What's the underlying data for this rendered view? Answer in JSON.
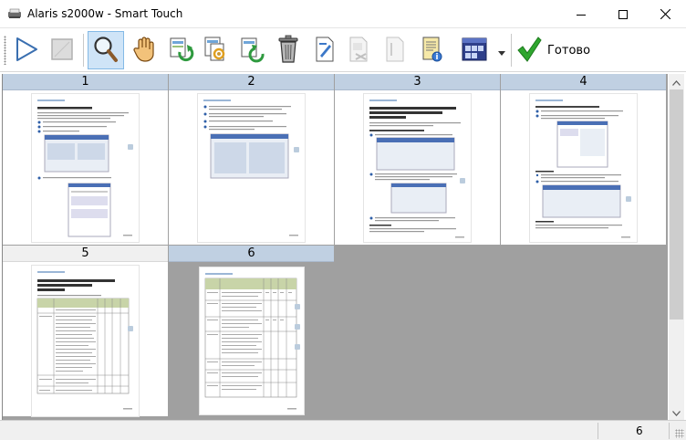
{
  "window": {
    "title": "Alaris s2000w - Smart Touch",
    "minimize_icon": "minimize-icon",
    "maximize_icon": "maximize-icon",
    "close_icon": "close-icon"
  },
  "toolbar": {
    "buttons": [
      {
        "name": "play-button",
        "icon": "play-icon"
      },
      {
        "name": "stop-button",
        "icon": "stop-icon",
        "disabled": true
      },
      {
        "name": "zoom-button",
        "icon": "magnifier-icon",
        "active": true
      },
      {
        "name": "pan-button",
        "icon": "hand-icon"
      },
      {
        "name": "rotate-right-button",
        "icon": "rotate-right-icon"
      },
      {
        "name": "rotate-left-button",
        "icon": "rotate-left-icon"
      },
      {
        "name": "flip-button",
        "icon": "flip-icon"
      },
      {
        "name": "delete-button",
        "icon": "trash-icon"
      },
      {
        "name": "insert-page-button",
        "icon": "insert-page-icon"
      },
      {
        "name": "crop-button",
        "icon": "crop-icon",
        "disabled": true
      },
      {
        "name": "split-button",
        "icon": "split-page-icon",
        "disabled": true
      },
      {
        "name": "page-info-button",
        "icon": "page-info-icon"
      },
      {
        "name": "view-mode-button",
        "icon": "view-mode-icon"
      }
    ],
    "done_label": "Готово",
    "done_icon": "checkmark-icon"
  },
  "pages": [
    {
      "number": "1"
    },
    {
      "number": "2"
    },
    {
      "number": "3"
    },
    {
      "number": "4"
    },
    {
      "number": "5"
    },
    {
      "number": "6",
      "selected": true
    }
  ],
  "status": {
    "page_count": "6"
  },
  "colors": {
    "header_blue": "#c0d0e2",
    "selection_bg": "#cfe4f7",
    "canvas_gray": "#a0a0a0",
    "check_green": "#2fa62f"
  }
}
